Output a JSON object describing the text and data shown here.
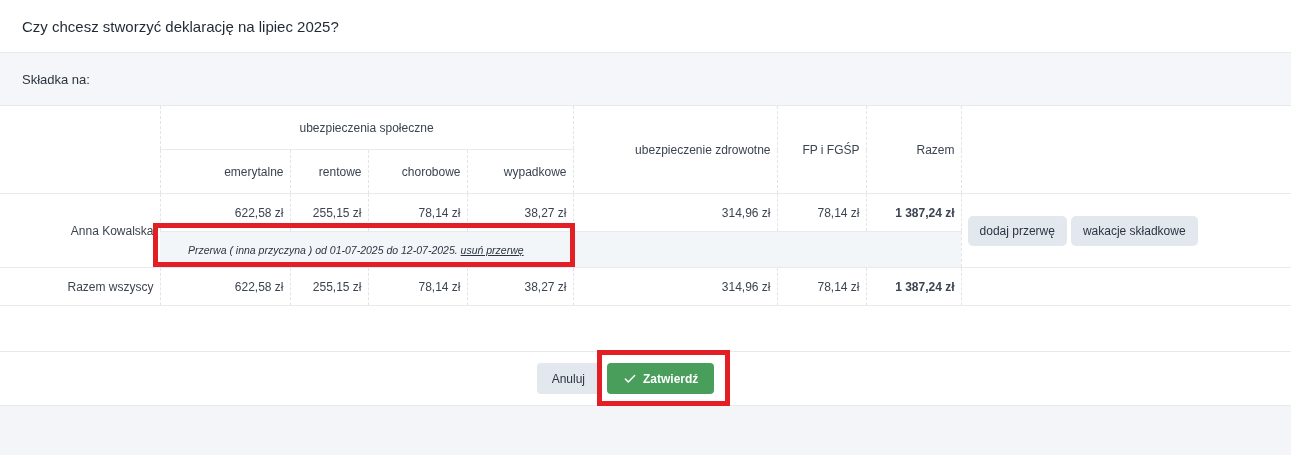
{
  "title": "Czy chcesz stworzyć deklarację na lipiec 2025?",
  "section": {
    "label": "Składka na:"
  },
  "table": {
    "group_header": "ubezpieczenia społeczne",
    "sub_columns": [
      "emerytalne",
      "rentowe",
      "chorobowe",
      "wypadkowe"
    ],
    "columns": [
      "ubezpieczenie zdrowotne",
      "FP i FGŚP",
      "Razem"
    ],
    "rows": [
      {
        "name": "Anna Kowalska",
        "values": [
          "622,58 zł",
          "255,15 zł",
          "78,14 zł",
          "38,27 zł",
          "314,96 zł",
          "78,14 zł",
          "1 387,24 zł"
        ],
        "break": {
          "text": "Przerwa ( inna przyczyna ) od 01-07-2025 do 12-07-2025.",
          "link": "usuń przerwę",
          "highlighted": true
        },
        "actions": [
          "dodaj przerwę",
          "wakacje składkowe"
        ]
      }
    ],
    "total": {
      "name": "Razem wszyscy",
      "values": [
        "622,58 zł",
        "255,15 zł",
        "78,14 zł",
        "38,27 zł",
        "314,96 zł",
        "78,14 zł",
        "1 387,24 zł"
      ]
    }
  },
  "buttons": [
    {
      "label": "Anuluj",
      "kind": "secondary",
      "highlighted": false
    },
    {
      "label": "Zatwierdź",
      "kind": "primary",
      "highlighted": true
    }
  ]
}
